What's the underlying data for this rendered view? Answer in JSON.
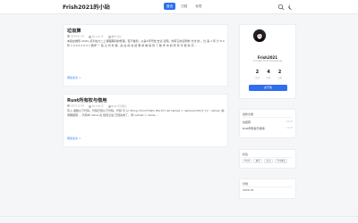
{
  "header": {
    "brand": "Frish2021的小站",
    "nav": [
      {
        "label": "首页",
        "active": true
      },
      {
        "label": "归档",
        "active": false
      },
      {
        "label": "标签",
        "active": false
      }
    ],
    "icons": [
      "search-icon",
      "moon-icon"
    ]
  },
  "posts": [
    {
      "title": "垃圾算",
      "meta": [
        "2024-01-10",
        "约 1.2k 字",
        "数学 杂记"
      ],
      "excerpt": "本段在推导 ASOG 系列在大二上课程期间的整理。若不做到，从第1年开始 去试 证明。他有它的证明求 方法 的 。比 第 1 年 计 8 0 年 1 0 0 0 2 0 2 1 数学 一 段 之 内 处 数 , 最 后 的 总 结 果 求 解 得 到 了 数 学 中 的 所 有 可 能 情 况 ...",
      "read_more": "阅读全文 >"
    },
    {
      "title": "Rust所有权与借用",
      "meta": [
        "2023-12-20",
        "约 2.0k 字",
        "Rust 学习笔记"
      ],
      "excerpt": "写入 函数以下代码，代码已经以下代码，代码 可 以 String::from(\"Hello World\") let name2 = name;println!(\"{}\", name); 编译器报错 ... 代码中 name 在 赋值之后 已经失效了，则 name2 = name ...",
      "read_more": "阅读全文 >"
    }
  ],
  "profile": {
    "name": "Frish2021",
    "motto": "A Coder From Everything",
    "stats": [
      {
        "value": "2",
        "label": "文章"
      },
      {
        "value": "4",
        "label": "标签"
      },
      {
        "value": "2",
        "label": "分类"
      }
    ],
    "follow_label": "关于我"
  },
  "recent": {
    "title": "最新文章",
    "items": [
      {
        "label": "垃圾算",
        "date": "01-10"
      },
      {
        "label": "Rust所有权与借用",
        "date": "12-20"
      }
    ]
  },
  "tags": {
    "title": "标签",
    "items": [
      "Rust",
      "数学",
      "杂记",
      "学习笔记"
    ]
  },
  "archive": {
    "title": "归档",
    "items": [
      "2024-01"
    ]
  },
  "colors": {
    "accent": "#2f6fed",
    "background": "#f5f6f8"
  }
}
